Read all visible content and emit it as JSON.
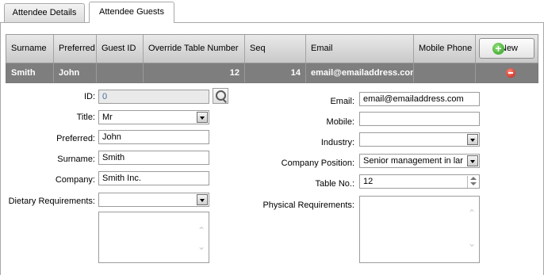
{
  "tabs": [
    "Attendee Details",
    "Attendee Guests"
  ],
  "grid": {
    "headers": [
      "Surname",
      "Preferred",
      "Guest ID",
      "Override Table Number",
      "Seq",
      "Email",
      "Mobile Phone"
    ],
    "new_button": "New",
    "row": {
      "surname": "Smith",
      "preferred": "John",
      "guest_id": "",
      "override_table_number": "12",
      "seq": "14",
      "email": "email@emailaddress.com",
      "mobile_phone": ""
    }
  },
  "form": {
    "id": {
      "label": "ID:",
      "value": "0"
    },
    "title": {
      "label": "Title:",
      "value": "Mr"
    },
    "preferred": {
      "label": "Preferred:",
      "value": "John"
    },
    "surname": {
      "label": "Surname:",
      "value": "Smith"
    },
    "company": {
      "label": "Company:",
      "value": "Smith Inc."
    },
    "dietary": {
      "label": "Dietary Requirements:",
      "value": ""
    },
    "email": {
      "label": "Email:",
      "value": "email@emailaddress.com"
    },
    "mobile": {
      "label": "Mobile:",
      "value": ""
    },
    "industry": {
      "label": "Industry:",
      "value": ""
    },
    "company_position": {
      "label": "Company Position:",
      "value": "Senior management in lar"
    },
    "table_no": {
      "label": "Table No.:",
      "value": "12"
    },
    "physical": {
      "label": "Physical Requirements:",
      "value": ""
    }
  }
}
